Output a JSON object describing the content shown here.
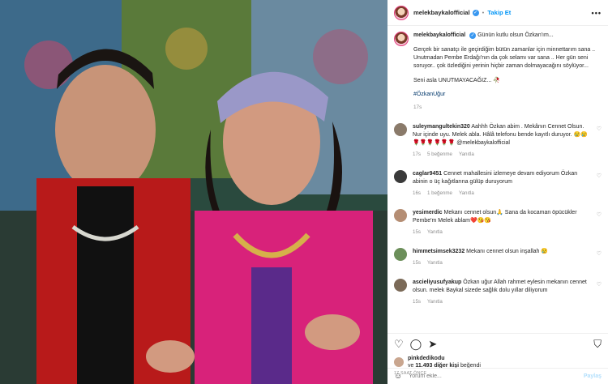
{
  "header": {
    "username": "melekbaykalofficial",
    "separator": "•",
    "follow_label": "Takip Et",
    "more_label": "•••"
  },
  "caption": {
    "username": "melekbaykalofficial",
    "headline": "Günün kutlu olsun Özkan'ım...",
    "paragraph1": "Gerçek bir sanatçı ile geçirdiğim bütün zamanlar için minnettarım sana .. Unutmadan Pembe Erdağı'nın da çok selamı var sana .. Her gün seni soruyor.. çok özlediğini yerinin hiçbir zaman dolmayacağını söylüyor...",
    "paragraph2": "Seni asla UNUTMAYACAĞIZ... 🥀",
    "hashtag": "#ÖzkanUğur",
    "time": "17s"
  },
  "comments": [
    {
      "username": "suleymangultekin320",
      "text": "Aahhh Özkan abim . Mekânın Cennet Olsun. Nur içinde uyu. Melek abla. Hâlâ telefonu bende kayıtlı duruyor. 😢😢 🌹🌹🌹🌹🌹🌹 @melekbaykalofficial",
      "time": "17s",
      "likes": "5 beğenme",
      "reply": "Yanıtla",
      "avatar_color": "#8a7a6a"
    },
    {
      "username": "caglar9451",
      "text": "Cennet mahallesini izlemeye devam ediyorum Özkan abinin o üç kağıtlarına gülüp duruyorum",
      "time": "16s",
      "likes": "1 beğenme",
      "reply": "Yanıtla",
      "avatar_color": "#3a3a3a"
    },
    {
      "username": "yesimerdic",
      "text": "Mekanı cennet olsun🙏 Sana da kocaman öpücükler Pembe'm Melek ablam❤️😘😘",
      "time": "15s",
      "likes": "",
      "reply": "Yanıtla",
      "avatar_color": "#b58e74"
    },
    {
      "username": "himmetsimsek3232",
      "text": "Mekanı cennet olsun inşallah 😢",
      "time": "15s",
      "likes": "",
      "reply": "Yanıtla",
      "avatar_color": "#6c8f5a"
    },
    {
      "username": "ascieliyusufyakup",
      "text": "Özkan uğur Allah rahmet eylesin mekanın cennet olsun. melek Baykal sizede sağlık dolu yıllar diliyorum",
      "time": "15s",
      "likes": "",
      "reply": "Yanıtla",
      "avatar_color": "#7b6a58"
    }
  ],
  "actions": {
    "liked_by": "pinkdedikodu",
    "and_label": "ve",
    "others_count": "11.493 diğer kişi",
    "liked_suffix": "beğendi",
    "time_ago": "17 SAAT ÖNCE"
  },
  "comment_box": {
    "placeholder": "Yorum ekle...",
    "post_label": "Paylaş"
  },
  "colors": {
    "accent": "#0095f6",
    "verified": "#3897f0",
    "muted": "#8e8e8e"
  }
}
